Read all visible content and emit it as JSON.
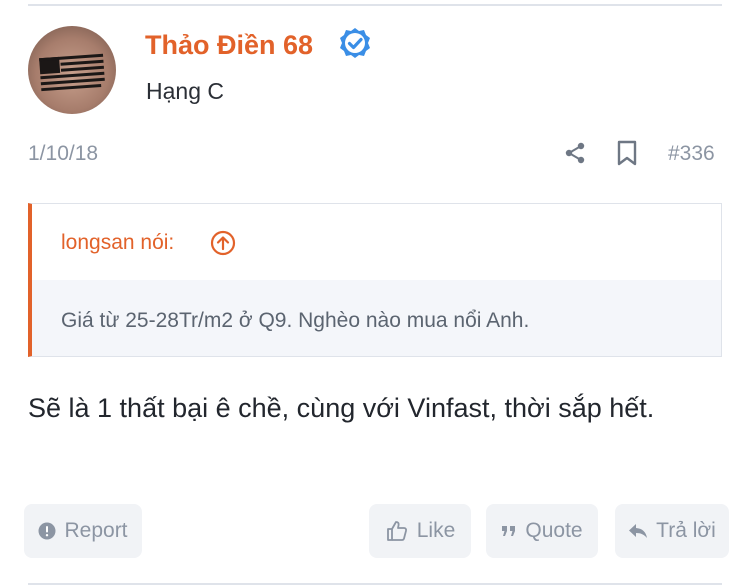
{
  "post": {
    "author": {
      "name": "Thảo Điền 68",
      "rank": "Hạng C",
      "verified": true
    },
    "date": "1/10/18",
    "number": "#336",
    "quote": {
      "author_line": "longsan nói:",
      "text": "Giá từ 25-28Tr/m2 ở Q9. Nghèo nào mua nổi Anh."
    },
    "body": "Sẽ là 1 thất bại ê chề, cùng với Vinfast, thời sắp hết."
  },
  "actions": {
    "report": "Report",
    "like": "Like",
    "quote": "Quote",
    "reply": "Trả lời"
  },
  "icons": {
    "verified": "verified-badge-icon",
    "share": "share-icon",
    "bookmark": "bookmark-icon",
    "quote_jump": "arrow-up-circle-icon",
    "report": "alert-circle-icon",
    "like": "thumbs-up-icon",
    "quote": "quote-marks-icon",
    "reply": "reply-arrow-icon"
  },
  "colors": {
    "accent": "#e2622a",
    "verified": "#3a8ee6",
    "muted": "#8c95a3",
    "text": "#22262d",
    "button_bg": "#f1f3f6",
    "quote_bg": "#f4f6fa"
  }
}
